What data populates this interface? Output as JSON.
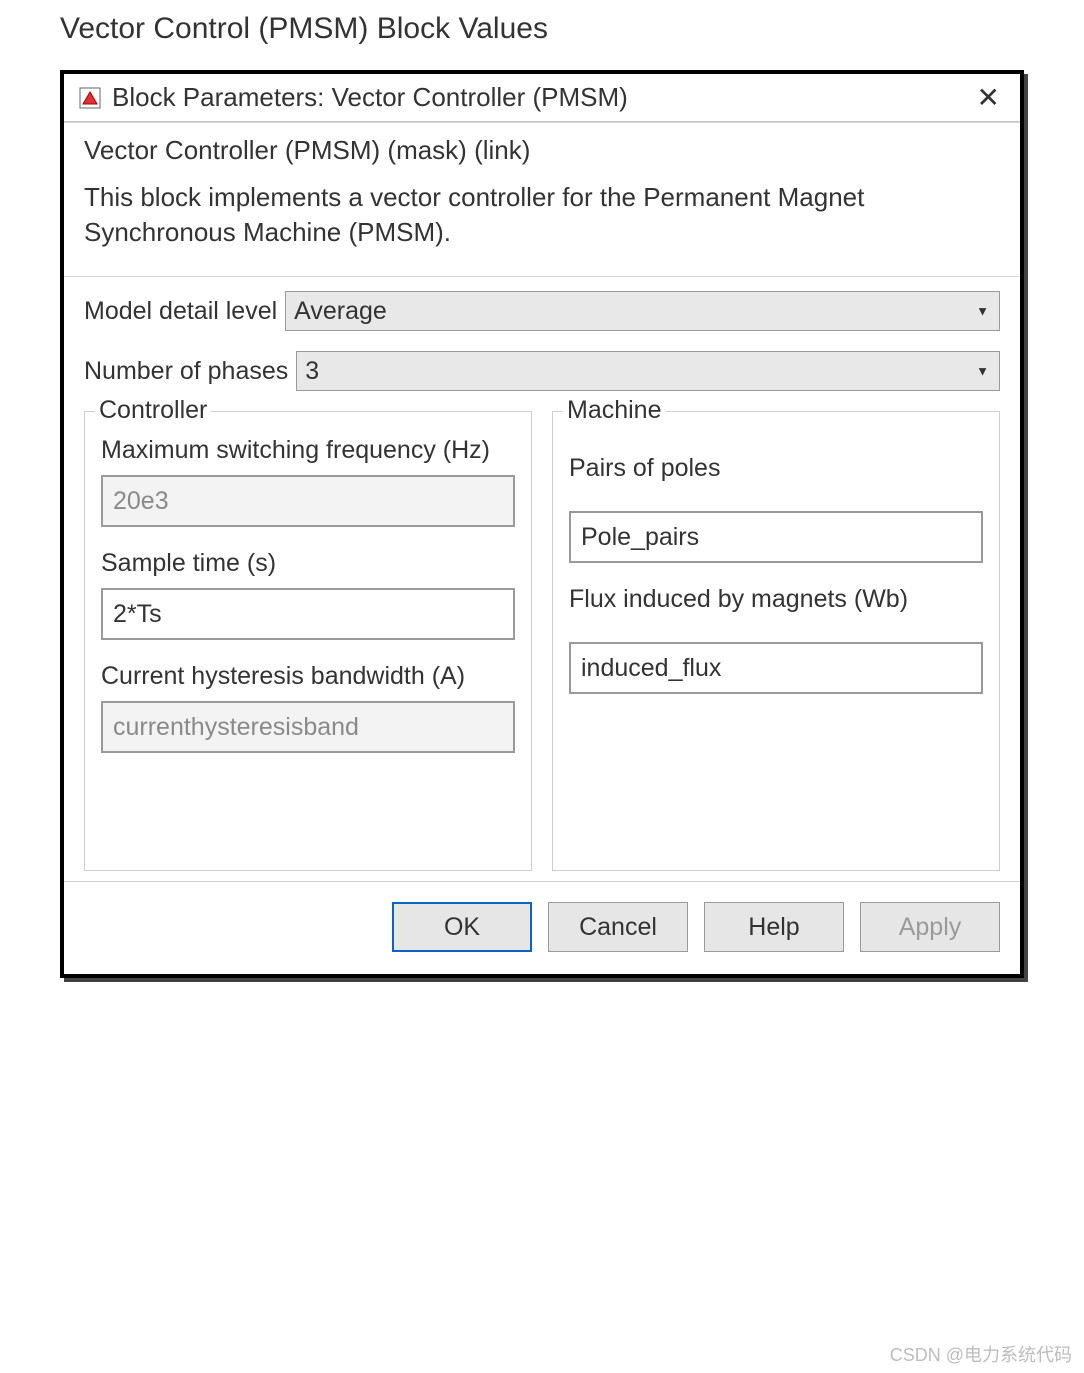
{
  "page": {
    "heading": "Vector Control (PMSM) Block Values"
  },
  "window": {
    "title": "Block Parameters: Vector Controller (PMSM)"
  },
  "header": {
    "mask_link": "Vector Controller (PMSM) (mask) (link)",
    "description": "This block implements a vector controller for the Permanent Magnet Synchronous Machine (PMSM)."
  },
  "dropdowns": {
    "model_detail_label": "Model detail level",
    "model_detail_value": "Average",
    "phases_label": "Number of phases",
    "phases_value": "3"
  },
  "controller": {
    "legend": "Controller",
    "max_switching_label": "Maximum switching frequency (Hz)",
    "max_switching_value": "20e3",
    "sample_time_label": "Sample time (s)",
    "sample_time_value": "2*Ts",
    "hysteresis_label": "Current hysteresis bandwidth (A)",
    "hysteresis_value": "currenthysteresisband"
  },
  "machine": {
    "legend": "Machine",
    "pairs_label": "Pairs of poles",
    "pairs_value": "Pole_pairs",
    "flux_label": "Flux induced by magnets (Wb)",
    "flux_value": "induced_flux"
  },
  "buttons": {
    "ok": "OK",
    "cancel": "Cancel",
    "help": "Help",
    "apply": "Apply"
  },
  "watermark": "CSDN @电力系统代码"
}
